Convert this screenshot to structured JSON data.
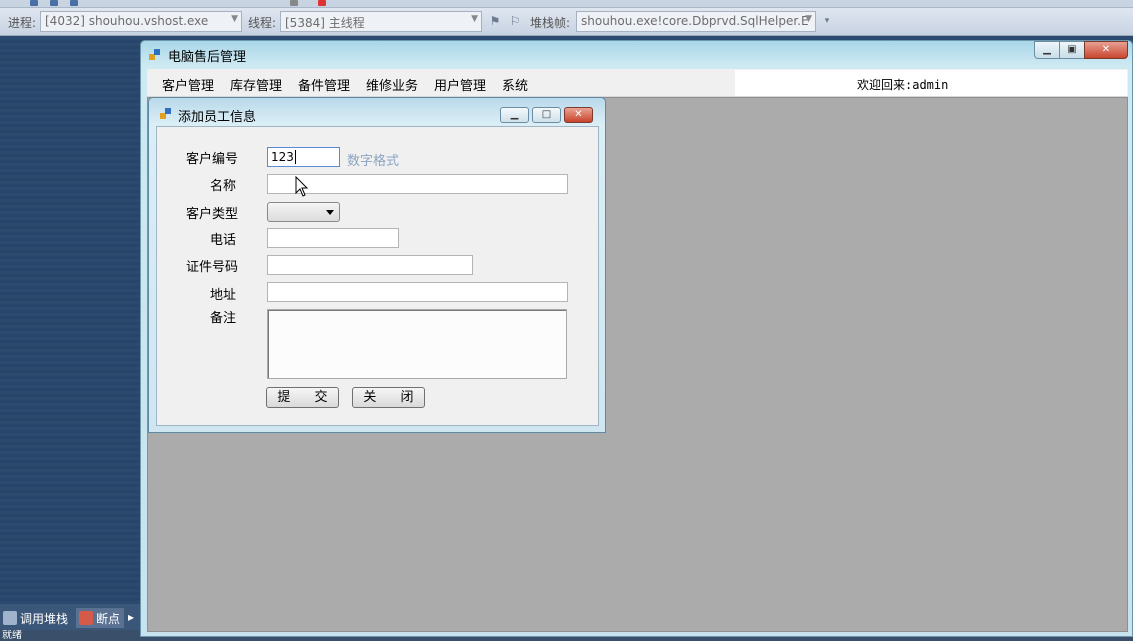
{
  "vs_toolbar": {
    "process_label": "进程:",
    "process_value": "[4032] shouhou.vshost.exe",
    "thread_label": "线程:",
    "thread_value": "[5384] 主线程",
    "stackframe_label": "堆栈帧:",
    "stackframe_value": "shouhou.exe!core.Dbprvd.SqlHelper.E"
  },
  "bottom_tabs": [
    {
      "label": "调用堆栈",
      "icon": "call-stack-icon"
    },
    {
      "label": "断点",
      "icon": "breakpoint-icon"
    }
  ],
  "status_text": "就绪",
  "main_window": {
    "title": "电脑售后管理",
    "menu": [
      "客户管理",
      "库存管理",
      "备件管理",
      "维修业务",
      "用户管理",
      "系统"
    ],
    "welcome": "欢迎回来:admin"
  },
  "dialog": {
    "title": "添加员工信息",
    "fields": {
      "customer_id_label": "客户编号",
      "customer_id_value": "123",
      "customer_id_hint": "数字格式",
      "name_label": "名称",
      "name_value": "",
      "type_label": "客户类型",
      "type_value": "",
      "phone_label": "电话",
      "phone_value": "",
      "id_number_label": "证件号码",
      "id_number_value": "",
      "address_label": "地址",
      "address_value": "",
      "remark_label": "备注",
      "remark_value": ""
    },
    "submit_label": "提 交",
    "close_label": "关 闭"
  },
  "colors": {
    "mdi_background": "#ababab",
    "title_bar": "#a8d6e8",
    "close_button": "#c8452f",
    "hint_text": "#8aa4c2"
  }
}
